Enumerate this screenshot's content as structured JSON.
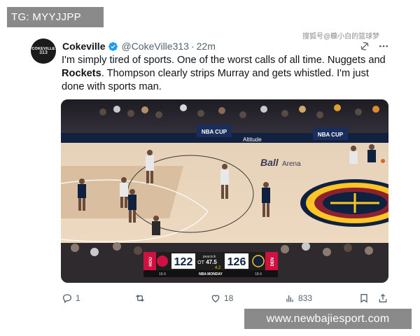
{
  "overlay": {
    "tag": "TG: MYYJJPP",
    "site": "www.newbajiesport.com"
  },
  "post": {
    "avatar_text_top": "COKEVILLE",
    "avatar_text_bottom": "313",
    "display_name": "Cokeville",
    "handle": "@CokeVille313",
    "separator": "·",
    "time": "22m",
    "watermark": "搜狐号@糠小白的篮球梦",
    "text_part1": "I'm simply tired of sports. One of the worst calls of all time. Nuggets and ",
    "text_bold": "Rockets",
    "text_part2": ". Thompson clearly strips Murray and gets whistled. I'm just done with sports man.",
    "icons": {
      "verified": "verified-badge-icon",
      "grok": "grok-icon",
      "more": "more-icon"
    },
    "accent_color": "#1d9bf0"
  },
  "media": {
    "court_boards": [
      "NBA CUP",
      "NBA CUP",
      "Altitude",
      "Arena"
    ],
    "scorebug": {
      "away_abbr": "HOU",
      "away_score": "122",
      "away_record": "16-6",
      "home_abbr": "DEN",
      "home_score": "126",
      "home_record": "18-6",
      "network": "peacock",
      "clock": "47.5",
      "period": "OT",
      "shot_clock": "4.2",
      "show": "NBA MONDAY"
    }
  },
  "actions": {
    "reply_count": "1",
    "retweet_count": "",
    "like_count": "18",
    "views_count": "833",
    "icons": [
      "reply-icon",
      "retweet-icon",
      "like-icon",
      "views-icon",
      "bookmark-icon",
      "share-icon"
    ]
  }
}
